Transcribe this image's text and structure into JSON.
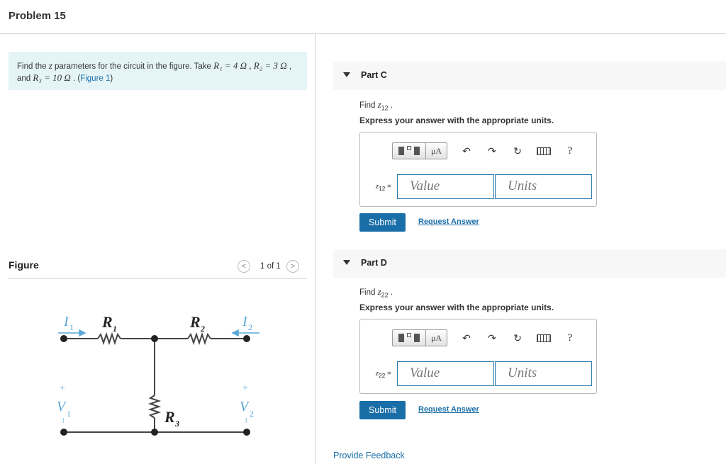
{
  "header": {
    "title": "Problem 15"
  },
  "problem": {
    "text_a": "Find the ",
    "z": "z",
    "text_b": " parameters for the circuit in the figure. Take ",
    "r1_eq": "R₁ = 4 Ω , ",
    "r2_eq": "R₂ = 3 Ω",
    "text_c": " , and ",
    "r3_eq": "R₃ = 10 Ω",
    "text_d": " . (",
    "figure_link": "Figure 1",
    "text_e": ")"
  },
  "figure": {
    "title": "Figure",
    "prev": "<",
    "next": ">",
    "counter": "1 of 1",
    "labels": {
      "I1": "I",
      "I1_sub": "1",
      "I2": "I",
      "I2_sub": "2",
      "R1": "R",
      "R1_sub": "1",
      "R2": "R",
      "R2_sub": "2",
      "R3": "R",
      "R3_sub": "3",
      "V1": "V",
      "V1_sub": "1",
      "V2": "V",
      "V2_sub": "2",
      "plus": "+",
      "minus": "–"
    },
    "colors": {
      "current": "#5aa7d6",
      "wire": "#444444"
    }
  },
  "parts": [
    {
      "label": "Part C",
      "find_text": "Find ",
      "var": "z",
      "var_sub": "12",
      "find_end": " .",
      "express": "Express your answer with the appropriate units.",
      "eq_var": "z",
      "eq_sub": "12",
      "eq_sign": " =",
      "value_placeholder": "Value",
      "units_placeholder": "Units",
      "submit": "Submit",
      "request": "Request Answer"
    },
    {
      "label": "Part D",
      "find_text": "Find ",
      "var": "z",
      "var_sub": "22",
      "find_end": " .",
      "express": "Express your answer with the appropriate units.",
      "eq_var": "z",
      "eq_sub": "22",
      "eq_sign": " =",
      "value_placeholder": "Value",
      "units_placeholder": "Units",
      "submit": "Submit",
      "request": "Request Answer"
    }
  ],
  "toolbar": {
    "units_btn": "μA",
    "undo": "↶",
    "redo": "↷",
    "reset": "↻",
    "help": "?",
    "icons": [
      "templates-icon",
      "units-icon",
      "undo-icon",
      "redo-icon",
      "reset-icon",
      "keyboard-icon",
      "help-icon"
    ]
  },
  "footer": {
    "feedback": "Provide Feedback"
  },
  "colors": {
    "accent": "#1a6ea8",
    "problem_bg": "#e5f4f7",
    "part_bg": "#f7f7f7"
  }
}
